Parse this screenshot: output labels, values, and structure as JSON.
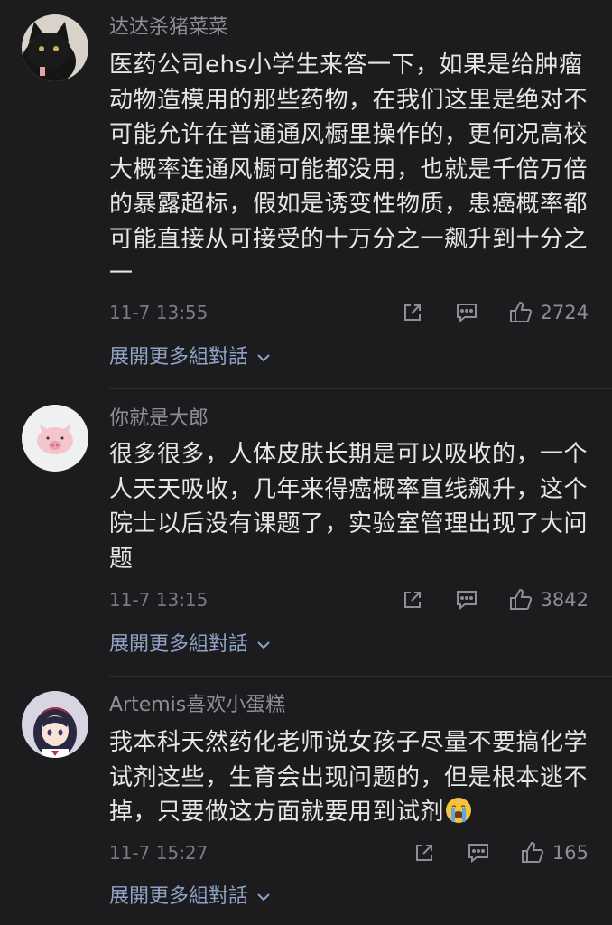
{
  "comments": [
    {
      "username": "达达杀猪菜菜",
      "avatar": "cat-avatar",
      "text": "医药公司ehs小学生来答一下，如果是给肿瘤动物造模用的那些药物，在我们这里是绝对不可能允许在普通通风橱里操作的，更何况高校大概率连通风橱可能都没用，也就是千倍万倍的暴露超标，假如是诱变性物质，患癌概率都可能直接从可接受的十万分之一飙升到十分之一",
      "time": "11-7 13:55",
      "likes": "2724",
      "expand": "展開更多組對話"
    },
    {
      "username": "你就是大郎",
      "avatar": "pig-avatar",
      "text": "很多很多，人体皮肤长期是可以吸收的，一个人天天吸收，几年来得癌概率直线飙升，这个院士以后没有课题了，实验室管理出现了大问题",
      "time": "11-7 13:15",
      "likes": "3842",
      "expand": "展開更多組對話"
    },
    {
      "username": "Artemis喜欢小蛋糕",
      "avatar": "anime-girl-avatar",
      "text": "我本科天然药化老师说女孩子尽量不要搞化学试剂这些，生育会出现问题的，但是根本逃不掉，只要做这方面就要用到试剂",
      "emoji": "crying-face-emoji",
      "time": "11-7 15:27",
      "likes": "165",
      "expand": "展開更多組對話"
    }
  ],
  "icons": [
    "share-icon",
    "reply-icon",
    "thumbs-up-icon",
    "chevron-down-icon"
  ],
  "colors": {
    "background": "#1c1c1e",
    "text": "#e6e6e6",
    "muted": "#8e8e93",
    "link": "#8fa3c6"
  }
}
